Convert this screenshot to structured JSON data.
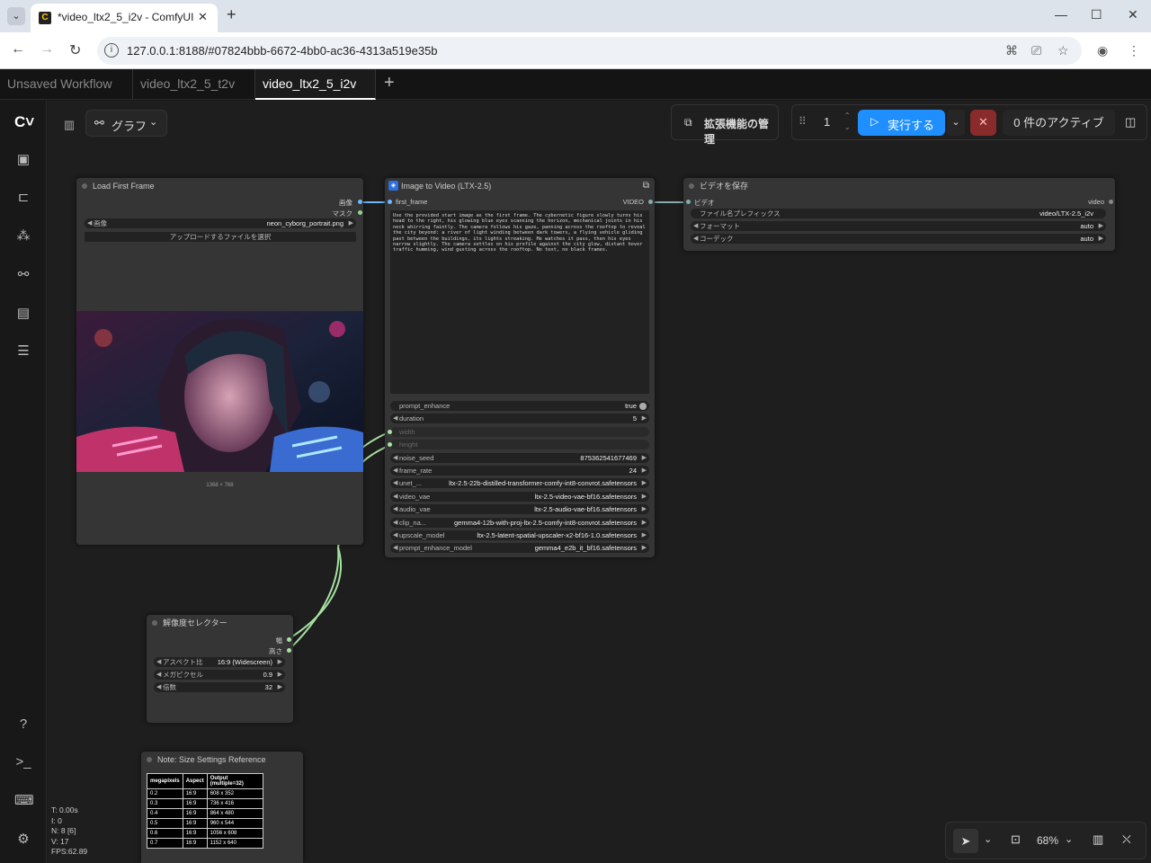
{
  "browser": {
    "tab_title": "*video_ltx2_5_i2v - ComfyUI",
    "url": "127.0.0.1:8188/#07824bbb-6672-4bb0-ac36-4313a519e35b",
    "new_tab": "+",
    "min": "—",
    "max": "☐",
    "close": "✕"
  },
  "workflow_tabs": [
    {
      "label": "Unsaved Workflow"
    },
    {
      "label": "video_ltx2_5_t2v"
    },
    {
      "label": "video_ltx2_5_i2v"
    }
  ],
  "toolbar": {
    "graph_label": "グラフ",
    "extensions_label": "拡張機能の管理",
    "queue_count": "1",
    "run_label": "実行する",
    "active_label": "0 件のアクティブ"
  },
  "load_node": {
    "title": "Load First Frame",
    "outputs": [
      "画像",
      "マスク"
    ],
    "image_label": "画像",
    "image_value": "neon_cyborg_portrait.png",
    "upload_label": "アップロードするファイルを選択",
    "dims": "1368 × 768"
  },
  "i2v_node": {
    "title": "Image to Video (LTX-2.5)",
    "input": "first_frame",
    "output": "VIDEO",
    "prompt": "Use the provided start image as the first frame. The cybernetic figure slowly turns his head to the right, his glowing blue eyes scanning the horizon, mechanical joints in his neck whirring faintly. The camera follows his gaze, panning across the rooftop to reveal the city beyond: a river of light winding between dark towers, a flying vehicle gliding past between the buildings, its lights streaking. He watches it pass, then his eyes narrow slightly. The camera settles on his profile against the city glow, distant hover traffic humming, wind gusting across the rooftop. No text, no black frames.",
    "widgets": [
      {
        "label": "prompt_enhance",
        "value": "true"
      },
      {
        "label": "duration",
        "value": "5"
      },
      {
        "label": "width",
        "value": ""
      },
      {
        "label": "height",
        "value": ""
      },
      {
        "label": "noise_seed",
        "value": "875362541677469"
      },
      {
        "label": "frame_rate",
        "value": "24"
      },
      {
        "label": "unet_...",
        "value": "ltx-2.5-22b-distilled-transformer-comfy-int8-convrot.safetensors"
      },
      {
        "label": "video_vae",
        "value": "ltx-2.5-video-vae-bf16.safetensors"
      },
      {
        "label": "audio_vae",
        "value": "ltx-2.5-audio-vae-bf16.safetensors"
      },
      {
        "label": "clip_na...",
        "value": "gemma4-12b-with-proj-ltx-2.5-comfy-int8-convrot.safetensors"
      },
      {
        "label": "upscale_model",
        "value": "ltx-2.5-latent-spatial-upscaler-x2-bf16-1.0.safetensors"
      },
      {
        "label": "prompt_enhance_model",
        "value": "gemma4_e2b_it_bf16.safetensors"
      }
    ]
  },
  "save_node": {
    "title": "ビデオを保存",
    "input": "ビデオ",
    "output": "video",
    "widgets": [
      {
        "label": "ファイル名プレフィックス",
        "value": "video/LTX-2.5_i2v"
      },
      {
        "label": "フォーマット",
        "value": "auto"
      },
      {
        "label": "コーデック",
        "value": "auto"
      }
    ]
  },
  "res_node": {
    "title": "解像度セレクター",
    "outputs": [
      "幅",
      "高さ"
    ],
    "widgets": [
      {
        "label": "アスペクト比",
        "value": "16:9 (Widescreen)"
      },
      {
        "label": "メガピクセル",
        "value": "0.9"
      },
      {
        "label": "倍数",
        "value": "32"
      }
    ]
  },
  "note_node": {
    "title": "Note: Size Settings Reference",
    "headers": [
      "megapixels",
      "Aspect",
      "Output (multiple=32)"
    ],
    "rows": [
      [
        "0.2",
        "16:9",
        "608 x 352"
      ],
      [
        "0.3",
        "16:9",
        "736 x 416"
      ],
      [
        "0.4",
        "16:9",
        "864 x 480"
      ],
      [
        "0.5",
        "16:9",
        "960 x 544"
      ],
      [
        "0.6",
        "16:9",
        "1056 x 608"
      ],
      [
        "0.7",
        "16:9",
        "1152 x 640"
      ]
    ]
  },
  "stats": [
    "T: 0.00s",
    "I: 0",
    "N: 8 [6]",
    "V: 17",
    "FPS:62.89"
  ],
  "zoom": "68%",
  "colors": {
    "accent": "#1f8fff",
    "cancel": "#8a2b2b",
    "link": "#6fb7ff",
    "green_link": "#a6e3a1"
  }
}
